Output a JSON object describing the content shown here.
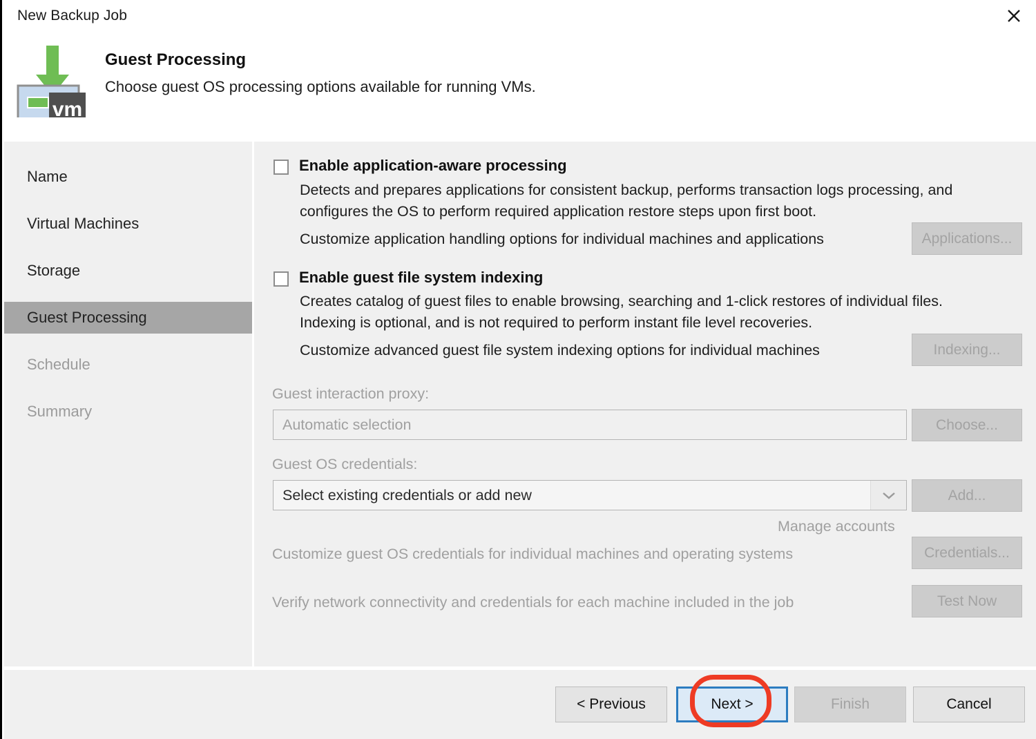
{
  "window": {
    "title": "New Backup Job",
    "close_icon": "close-icon"
  },
  "header": {
    "icon": "vm-backup-icon",
    "title": "Guest Processing",
    "subtitle": "Choose guest OS processing options available for running VMs."
  },
  "sidebar": {
    "items": [
      {
        "label": "Name",
        "state": "normal"
      },
      {
        "label": "Virtual Machines",
        "state": "normal"
      },
      {
        "label": "Storage",
        "state": "normal"
      },
      {
        "label": "Guest Processing",
        "state": "active"
      },
      {
        "label": "Schedule",
        "state": "disabled"
      },
      {
        "label": "Summary",
        "state": "disabled"
      }
    ]
  },
  "main": {
    "app_aware": {
      "checkbox_checked": false,
      "title": "Enable application-aware processing",
      "desc_line1": "Detects and prepares applications for consistent backup, performs transaction logs processing, and",
      "desc_line2": "configures the OS to perform required application restore steps upon first boot.",
      "customize_text": "Customize application handling options for individual machines and applications",
      "button_label": "Applications..."
    },
    "indexing": {
      "checkbox_checked": false,
      "title": "Enable guest file system indexing",
      "desc_line1": "Creates catalog of guest files to enable browsing, searching and 1-click restores of individual files.",
      "desc_line2": "Indexing is optional, and is not required to perform instant file level recoveries.",
      "customize_text": "Customize advanced guest file system indexing options for individual machines",
      "button_label": "Indexing..."
    },
    "guest_proxy": {
      "label": "Guest interaction proxy:",
      "value": "Automatic selection",
      "button_label": "Choose..."
    },
    "guest_credentials": {
      "label": "Guest OS credentials:",
      "value": "Select existing credentials or add new",
      "dropdown_icon": "chevron-down-icon",
      "button_label": "Add...",
      "manage_accounts_link": "Manage accounts"
    },
    "customize_credentials": {
      "text": "Customize guest OS credentials for individual machines and operating systems",
      "button_label": "Credentials..."
    },
    "test_connectivity": {
      "text": "Verify network connectivity and credentials for each machine included in the job",
      "button_label": "Test Now"
    }
  },
  "footer": {
    "previous_label": "< Previous",
    "next_label": "Next >",
    "finish_label": "Finish",
    "cancel_label": "Cancel"
  },
  "colors": {
    "accent_focus": "#2c7cc0",
    "annotation_red": "#ee3b24",
    "active_nav": "#a6a6a6",
    "panel_bg": "#f0f0f0",
    "icon_green": "#6fbd54",
    "icon_vm_gray": "#4f4f4f",
    "icon_blue": "#c6d9ee"
  }
}
